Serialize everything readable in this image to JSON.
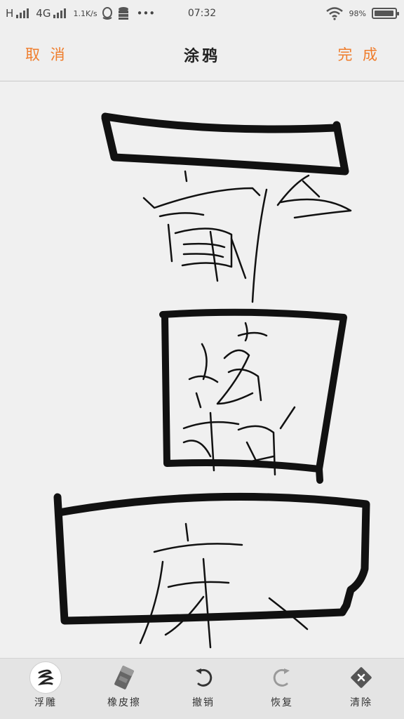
{
  "status_bar": {
    "carrier_text": "H",
    "network_type": "4G",
    "speed": "1.1K/s",
    "time": "07:32",
    "more": "•••",
    "battery_level": "98%",
    "battery_fraction": 0.98
  },
  "header": {
    "cancel_label": "取 消",
    "title": "涂鸦",
    "done_label": "完 成",
    "accent_color": "#ef7d2c"
  },
  "toolbar": {
    "tools": [
      {
        "label": "浮雕",
        "icon": "brush-icon",
        "active": true
      },
      {
        "label": "橡皮擦",
        "icon": "eraser-icon",
        "active": false
      },
      {
        "label": "撤销",
        "icon": "undo-icon",
        "active": false
      },
      {
        "label": "恢复",
        "icon": "redo-icon",
        "active": false
      },
      {
        "label": "清除",
        "icon": "clear-icon",
        "active": false
      }
    ]
  },
  "canvas": {
    "description_text": ""
  }
}
